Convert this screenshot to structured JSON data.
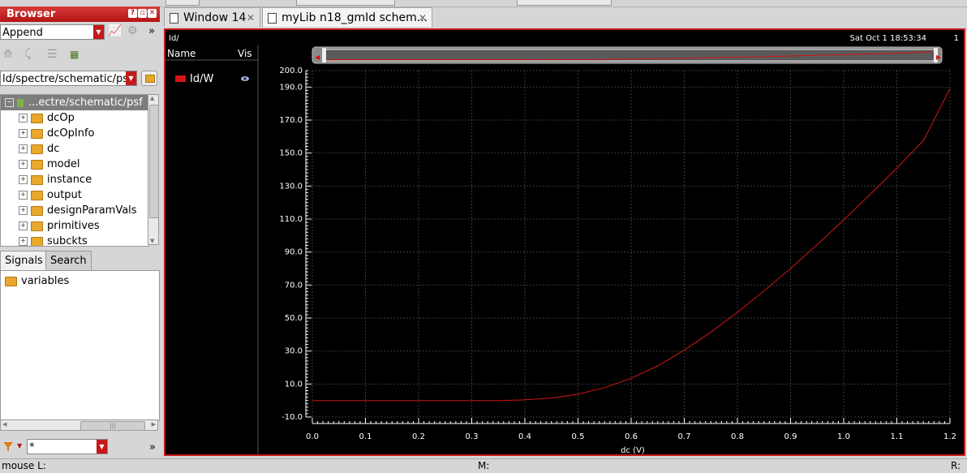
{
  "browser": {
    "title": "Browser",
    "mode_select": "Append",
    "path_select": "ld/spectre/schematic/psf",
    "tree": {
      "root": "...ectre/schematic/psf",
      "items": [
        "dcOp",
        "dcOpInfo",
        "dc",
        "model",
        "instance",
        "output",
        "designParamVals",
        "primitives",
        "subckts"
      ]
    },
    "tabs": [
      "Signals",
      "Search"
    ],
    "signal_items": [
      "variables"
    ],
    "filter_value": "*"
  },
  "window_tabs": [
    {
      "label": "Window 14"
    },
    {
      "label": "myLib n18_gmId schem..."
    }
  ],
  "plot": {
    "header_left": "Id/",
    "timestamp": "Sat Oct 1 18:53:34",
    "page_num": "1",
    "legend": {
      "col_name": "Name",
      "col_vis": "Vis",
      "trace_name": "Id/W",
      "trace_color": "#d41414"
    }
  },
  "chart_data": {
    "type": "line",
    "xlabel": "dc (V)",
    "ylabel": "",
    "xlim": [
      0.0,
      1.2
    ],
    "ylim": [
      -10.0,
      200.0
    ],
    "x_ticks": [
      0.0,
      0.1,
      0.2,
      0.3,
      0.4,
      0.5,
      0.6,
      0.7,
      0.8,
      0.9,
      1.0,
      1.1,
      1.2
    ],
    "y_ticks": [
      -10.0,
      10.0,
      30.0,
      50.0,
      70.0,
      90.0,
      110.0,
      130.0,
      150.0,
      170.0,
      190.0,
      200.0
    ],
    "grid": true,
    "series": [
      {
        "name": "Id/W",
        "color": "#d41414",
        "x": [
          0.0,
          0.1,
          0.2,
          0.3,
          0.35,
          0.4,
          0.45,
          0.5,
          0.55,
          0.6,
          0.65,
          0.7,
          0.75,
          0.8,
          0.85,
          0.9,
          0.95,
          1.0,
          1.05,
          1.1,
          1.15,
          1.2
        ],
        "y": [
          0.0,
          0.0,
          0.0,
          0.0,
          0.0,
          0.4,
          1.5,
          3.8,
          7.8,
          13.5,
          21.0,
          30.5,
          41.5,
          53.5,
          66.5,
          80.0,
          94.5,
          109.5,
          125.0,
          141.0,
          157.5,
          189.0
        ]
      }
    ]
  },
  "status_bar": {
    "left": "mouse L:",
    "middle": "M:",
    "right": "R:"
  }
}
